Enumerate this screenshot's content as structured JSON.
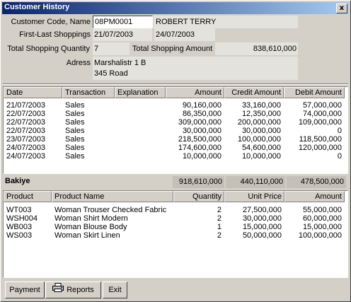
{
  "window": {
    "title": "Customer History",
    "close_glyph": "x"
  },
  "customer": {
    "code_label": "Customer Code, Name",
    "code": "08PM0001",
    "name": "ROBERT TERRY",
    "shoppings_label": "First-Last Shoppings",
    "first_shopping": "21/07/2003",
    "last_shopping": "24/07/2003",
    "qty_label": "Total Shopping Quantity",
    "qty": "7",
    "amount_label": "Total Shopping Amount",
    "amount": "838,610,000",
    "address_label": "Adress",
    "address_line1": "Marshalistr 1 B",
    "address_line2": "345 Road"
  },
  "transactions": {
    "columns": [
      "Date",
      "Transaction",
      "Explanation",
      "Amount",
      "Credit Amount",
      "Debit Amount"
    ],
    "rows": [
      [
        "21/07/2003",
        "Sales",
        "",
        "90,160,000",
        "33,160,000",
        "57,000,000"
      ],
      [
        "22/07/2003",
        "Sales",
        "",
        "86,350,000",
        "12,350,000",
        "74,000,000"
      ],
      [
        "22/07/2003",
        "Sales",
        "",
        "309,000,000",
        "200,000,000",
        "109,000,000"
      ],
      [
        "22/07/2003",
        "Sales",
        "",
        "30,000,000",
        "30,000,000",
        "0"
      ],
      [
        "23/07/2003",
        "Sales",
        "",
        "218,500,000",
        "100,000,000",
        "118,500,000"
      ],
      [
        "24/07/2003",
        "Sales",
        "",
        "174,600,000",
        "54,600,000",
        "120,000,000"
      ],
      [
        "24/07/2003",
        "Sales",
        "",
        "10,000,000",
        "10,000,000",
        "0"
      ]
    ]
  },
  "totals": {
    "label": "Bakiye",
    "amount": "918,610,000",
    "credit": "440,110,000",
    "debit": "478,500,000"
  },
  "products": {
    "columns": [
      "Product",
      "Product Name",
      "Quantity",
      "Unit Price",
      "Amount"
    ],
    "rows": [
      [
        "WT003",
        "Woman Trouser Checked Fabric",
        "2",
        "27,500,000",
        "55,000,000"
      ],
      [
        "WSH004",
        "Woman Shirt Modern",
        "2",
        "30,000,000",
        "60,000,000"
      ],
      [
        "WB003",
        "Woman Blouse Body",
        "1",
        "15,000,000",
        "15,000,000"
      ],
      [
        "WS003",
        "Woman Skirt Linen",
        "2",
        "50,000,000",
        "100,000,000"
      ]
    ]
  },
  "buttons": {
    "payment": "Payment",
    "reports": "Reports",
    "exit": "Exit"
  },
  "icons": {
    "reports": "printer-icon"
  }
}
